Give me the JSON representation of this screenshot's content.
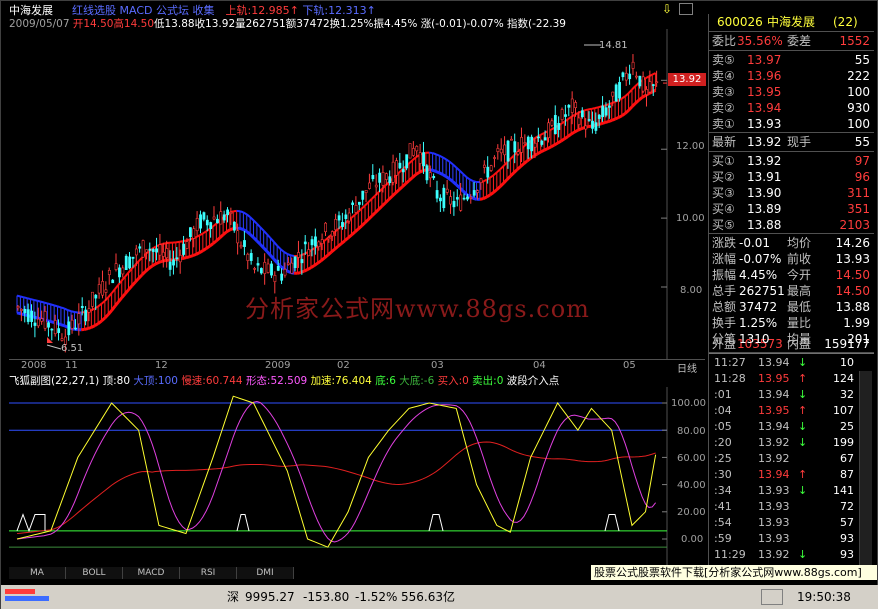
{
  "header": {
    "stock_name": "中海发展",
    "menu": [
      "红线选股",
      "MACD",
      "公式坛",
      "收集"
    ],
    "upper_track": "上轨:12.985",
    "lower_track": "下轨:12.313",
    "upper_arrow": "↑",
    "lower_arrow": "↑",
    "date": "2009/05/07",
    "open": "开14.50",
    "high": "高14.50",
    "low": "低13.88",
    "close": "收13.92",
    "volume": "量262751",
    "amount": "额37472",
    "turnover": "换1.25%",
    "amplitude": "振4.45%",
    "change": "涨(-0.01)-0.07%",
    "index": "指数(-22.39"
  },
  "main_chart": {
    "price_labels": [
      "14.00",
      "12.00",
      "10.00",
      "8.00"
    ],
    "current_price_tag": "13.92",
    "max_marker": "14.81",
    "min_marker": "6.51",
    "watermark": "分析家公式网www.88gs.com",
    "time_labels": [
      "2008",
      "11",
      "12",
      "2009",
      "02",
      "03",
      "04",
      "05"
    ],
    "corner_label": "日线"
  },
  "indicator": {
    "title": "飞狐副图(22,27,1)",
    "ding": "顶:80",
    "dading": "大顶:100",
    "mansu": "慢速:60.744",
    "xingtai": "形态:52.509",
    "jiasu": "加速:76.404",
    "di": "底:6",
    "dadi": "大底:-6",
    "mairu": "买入:0",
    "maichu": "卖出:0",
    "boduan": "波段介入点",
    "levels": [
      "100.00",
      "80.00",
      "60.00",
      "40.00",
      "20.00",
      "0.00"
    ]
  },
  "tabs": [
    "MA",
    "BOLL",
    "MACD",
    "RSI",
    "DMI"
  ],
  "quote": {
    "code": "600026",
    "name": "中海发展",
    "num": "(22)",
    "weibi_label": "委比",
    "weibi": "35.56%",
    "weicha_label": "委差",
    "weicha": "1552",
    "asks": [
      {
        "label": "卖⑤",
        "price": "13.97",
        "vol": "55"
      },
      {
        "label": "卖④",
        "price": "13.96",
        "vol": "222"
      },
      {
        "label": "卖③",
        "price": "13.95",
        "vol": "100"
      },
      {
        "label": "卖②",
        "price": "13.94",
        "vol": "930"
      },
      {
        "label": "卖①",
        "price": "13.93",
        "vol": "100"
      }
    ],
    "latest_label": "最新",
    "latest": "13.92",
    "xianshou_label": "现手",
    "xianshou": "55",
    "bids": [
      {
        "label": "买①",
        "price": "13.92",
        "vol": "97"
      },
      {
        "label": "买②",
        "price": "13.91",
        "vol": "96"
      },
      {
        "label": "买③",
        "price": "13.90",
        "vol": "311"
      },
      {
        "label": "买④",
        "price": "13.89",
        "vol": "351"
      },
      {
        "label": "买⑤",
        "price": "13.88",
        "vol": "2103"
      }
    ],
    "stats": [
      {
        "k1": "涨跌",
        "v1": "-0.01",
        "k2": "均价",
        "v2": "14.26"
      },
      {
        "k1": "涨幅",
        "v1": "-0.07%",
        "k2": "前收",
        "v2": "13.93"
      },
      {
        "k1": "振幅",
        "v1": "4.45%",
        "k2": "今开",
        "v2": "14.50"
      },
      {
        "k1": "总手",
        "v1": "262751",
        "k2": "最高",
        "v2": "14.50"
      },
      {
        "k1": "总额",
        "v1": "37472",
        "k2": "最低",
        "v2": "13.88"
      },
      {
        "k1": "换手",
        "v1": "1.25%",
        "k2": "量比",
        "v2": "1.99"
      },
      {
        "k1": "分笔",
        "v1": "1310",
        "k2": "均量",
        "v2": "201"
      }
    ],
    "waipan_label": "外盘",
    "waipan": "103573",
    "neipan_label": "内盘",
    "neipan": "159177"
  },
  "ticks": [
    {
      "t": "11:27",
      "p": "13.94",
      "a": "↓",
      "v": "10"
    },
    {
      "t": "11:28",
      "p": "13.95",
      "a": "↑",
      "v": "124"
    },
    {
      "t": ":01",
      "p": "13.94",
      "a": "↓",
      "v": "32"
    },
    {
      "t": ":04",
      "p": "13.95",
      "a": "↑",
      "v": "107"
    },
    {
      "t": ":05",
      "p": "13.94",
      "a": "↓",
      "v": "25"
    },
    {
      "t": ":20",
      "p": "13.92",
      "a": "↓",
      "v": "199"
    },
    {
      "t": ":25",
      "p": "13.92",
      "a": "",
      "v": "67"
    },
    {
      "t": ":30",
      "p": "13.94",
      "a": "↑",
      "v": "87"
    },
    {
      "t": ":34",
      "p": "13.93",
      "a": "↓",
      "v": "141"
    },
    {
      "t": ":41",
      "p": "13.93",
      "a": "",
      "v": "72"
    },
    {
      "t": ":54",
      "p": "13.93",
      "a": "",
      "v": "57"
    },
    {
      "t": ":59",
      "p": "13.93",
      "a": "",
      "v": "93"
    },
    {
      "t": "11:29",
      "p": "13.92",
      "a": "↓",
      "v": "93"
    }
  ],
  "ad_banner": "股票公式股票软件下载[分析家公式网www.88gs.com]",
  "status": {
    "index_label": "深",
    "index_value": "9995.27",
    "index_change": "-153.80",
    "index_pct": "-1.52%",
    "index_amount": "556.63亿",
    "clock": "19:50:38"
  },
  "colors": {
    "up": "#ff3c3c",
    "down": "#3cffff",
    "bg": "#000000",
    "band_red": "#ff0000",
    "band_blue": "#2a3cff"
  }
}
